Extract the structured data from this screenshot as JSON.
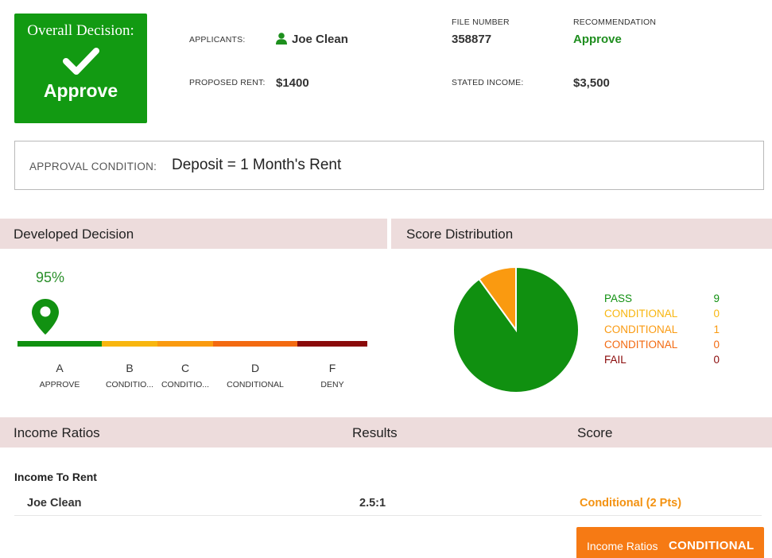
{
  "overall": {
    "title": "Overall Decision:",
    "value": "Approve",
    "color": "#129a12",
    "icon": "checkmark-icon"
  },
  "summary": {
    "applicants_label": "APPLICANTS:",
    "applicant_name": "Joe Clean",
    "applicant_icon": "person-icon",
    "file_number_label": "FILE NUMBER",
    "file_number": "358877",
    "recommendation_label": "RECOMMENDATION",
    "recommendation": "Approve",
    "proposed_rent_label": "PROPOSED RENT:",
    "proposed_rent": "$1400",
    "stated_income_label": "STATED INCOME:",
    "stated_income": "$3,500"
  },
  "approval_condition": {
    "label": "APPROVAL CONDITION:",
    "value": "Deposit = 1 Month's Rent"
  },
  "developed_decision": {
    "title": "Developed Decision",
    "percent_label": "95%",
    "percent": 95,
    "marker_icon": "map-pin-icon",
    "grades": [
      {
        "letter": "A",
        "label": "APPROVE",
        "color": "#109010"
      },
      {
        "letter": "B",
        "label": "CONDITIO...",
        "color": "#f8b60f"
      },
      {
        "letter": "C",
        "label": "CONDITIO...",
        "color": "#fa9a10"
      },
      {
        "letter": "D",
        "label": "CONDITIONAL",
        "color": "#f36a11"
      },
      {
        "letter": "F",
        "label": "DENY",
        "color": "#8a0a0a"
      }
    ]
  },
  "score_distribution": {
    "title": "Score Distribution"
  },
  "chart_data": {
    "type": "pie",
    "categories": [
      "PASS",
      "CONDITIONAL",
      "CONDITIONAL",
      "CONDITIONAL",
      "FAIL"
    ],
    "values": [
      9,
      0,
      1,
      0,
      0
    ],
    "colors": [
      "#109010",
      "#f8b60f",
      "#fa9a10",
      "#f36a11",
      "#8a0a0a"
    ],
    "legend_position": "right"
  },
  "income_ratios": {
    "title": "Income Ratios",
    "results_header": "Results",
    "score_header": "Score",
    "group_label": "Income To Rent",
    "rows": [
      {
        "name": "Joe Clean",
        "result": "2.5:1",
        "score": "Conditional (2 Pts)"
      }
    ],
    "badge_label": "Income Ratios",
    "badge_value": "CONDITIONAL",
    "badge_color": "#f67a14"
  }
}
